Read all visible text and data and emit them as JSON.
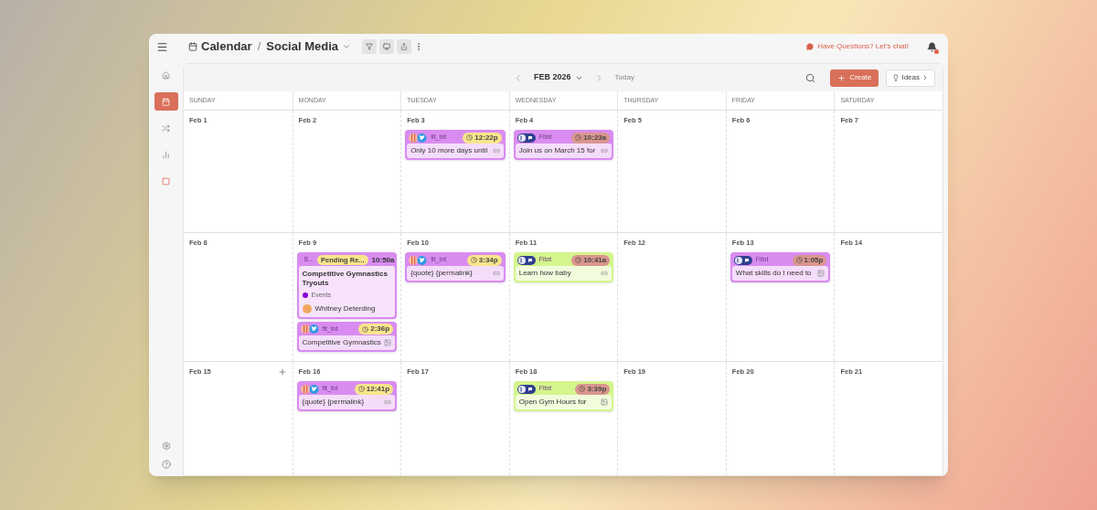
{
  "header": {
    "breadcrumb": [
      "Calendar",
      "Social Media"
    ],
    "separator": "/",
    "help_link": "Have Questions? Let's chat!",
    "notification_dot": true
  },
  "sidebar": {
    "items": [
      {
        "selected": false
      },
      {
        "selected": true
      },
      {
        "selected": false
      },
      {
        "selected": false
      },
      {
        "selected": false
      }
    ]
  },
  "toolbar": {
    "month": "FEB 2026",
    "today": "Today",
    "create": "Create",
    "ideas": "Ideas"
  },
  "weekdays": [
    "SUNDAY",
    "MONDAY",
    "TUESDAY",
    "WEDNESDAY",
    "THURSDAY",
    "FRIDAY",
    "SATURDAY"
  ],
  "weeks": [
    {
      "days": [
        {
          "date": "Feb 1",
          "add_button": false
        },
        {
          "date": "Feb 2",
          "add_button": false
        },
        {
          "date": "Feb 3",
          "add_button": false,
          "posts": [
            {
              "kind": "social",
              "avatar": {
                "kind": "striped"
              },
              "account": "fit_tnt",
              "time": {
                "text": "12:22p",
                "color": "#f8e58c"
              },
              "text": "Only 10 more days until",
              "attachment": {
                "kind": "link"
              },
              "color": "#d98cf0"
            }
          ]
        },
        {
          "date": "Feb 4",
          "add_button": false,
          "posts": [
            {
              "kind": "social",
              "avatar": {
                "kind": "logo"
              },
              "account": "Fitnt",
              "time": {
                "text": "10:23a",
                "color": "#d9968f"
              },
              "text": "Join us on March 15 for",
              "attachment": {
                "kind": "link"
              },
              "color": "#d98cf0"
            }
          ]
        },
        {
          "date": "Feb 5",
          "add_button": false
        },
        {
          "date": "Feb 6",
          "add_button": false
        },
        {
          "date": "Feb 7",
          "add_button": false
        }
      ]
    },
    {
      "days": [
        {
          "date": "Feb 8",
          "add_button": false
        },
        {
          "date": "Feb 9",
          "add_button": false,
          "posts": [
            {
              "kind": "event",
              "label": "S...",
              "status": {
                "text": "Pending Re...",
                "color": "#f8e58c"
              },
              "time": "10:50a",
              "title": "Competitive Gymnastics Tryouts",
              "category": {
                "name": "Events",
                "color": "#8a00d4"
              },
              "person": "Whitney Deterding",
              "color": "#d98cf0"
            },
            {
              "kind": "social",
              "avatar": {
                "kind": "striped"
              },
              "account": "fit_tnt",
              "time": {
                "text": "2:36p",
                "color": "#f8e58c"
              },
              "text": "Competitive Gymnastics",
              "attachment": {
                "kind": "image"
              },
              "color": "#d98cf0"
            }
          ]
        },
        {
          "date": "Feb 10",
          "add_button": false,
          "posts": [
            {
              "kind": "social",
              "avatar": {
                "kind": "striped"
              },
              "account": "fit_tnt",
              "time": {
                "text": "3:34p",
                "color": "#f8e58c"
              },
              "text": "{quote} {permalink}",
              "attachment": {
                "kind": "link"
              },
              "color": "#d98cf0"
            }
          ]
        },
        {
          "date": "Feb 11",
          "add_button": false,
          "posts": [
            {
              "kind": "social",
              "avatar": {
                "kind": "logo"
              },
              "account": "Fitnt",
              "time": {
                "text": "10:41a",
                "color": "#d9968f"
              },
              "text": "Learn how baby",
              "attachment": {
                "kind": "link"
              },
              "color": "#d4f58c"
            }
          ]
        },
        {
          "date": "Feb 12",
          "add_button": false
        },
        {
          "date": "Feb 13",
          "add_button": false,
          "posts": [
            {
              "kind": "social",
              "avatar": {
                "kind": "logo"
              },
              "account": "Fitnt",
              "time": {
                "text": "1:05p",
                "color": "#d9968f"
              },
              "text": "What skills do I need to",
              "attachment": {
                "kind": "image"
              },
              "color": "#d98cf0"
            }
          ]
        },
        {
          "date": "Feb 14",
          "add_button": false
        }
      ]
    },
    {
      "days": [
        {
          "date": "Feb 15",
          "add_button": true
        },
        {
          "date": "Feb 16",
          "add_button": false,
          "posts": [
            {
              "kind": "social",
              "avatar": {
                "kind": "striped"
              },
              "account": "fit_tnt",
              "time": {
                "text": "12:41p",
                "color": "#f8e58c"
              },
              "text": "{quote} {permalink}",
              "attachment": {
                "kind": "link"
              },
              "color": "#d98cf0"
            }
          ]
        },
        {
          "date": "Feb 17",
          "add_button": false
        },
        {
          "date": "Feb 18",
          "add_button": false,
          "posts": [
            {
              "kind": "social",
              "avatar": {
                "kind": "logo"
              },
              "account": "Fitnt",
              "time": {
                "text": "3:39p",
                "color": "#d9968f"
              },
              "text": "Open Gym Hours for",
              "attachment": {
                "kind": "image"
              },
              "color": "#d4f58c"
            }
          ]
        },
        {
          "date": "Feb 19",
          "add_button": false
        },
        {
          "date": "Feb 20",
          "add_button": false
        },
        {
          "date": "Feb 21",
          "add_button": false
        }
      ]
    }
  ]
}
